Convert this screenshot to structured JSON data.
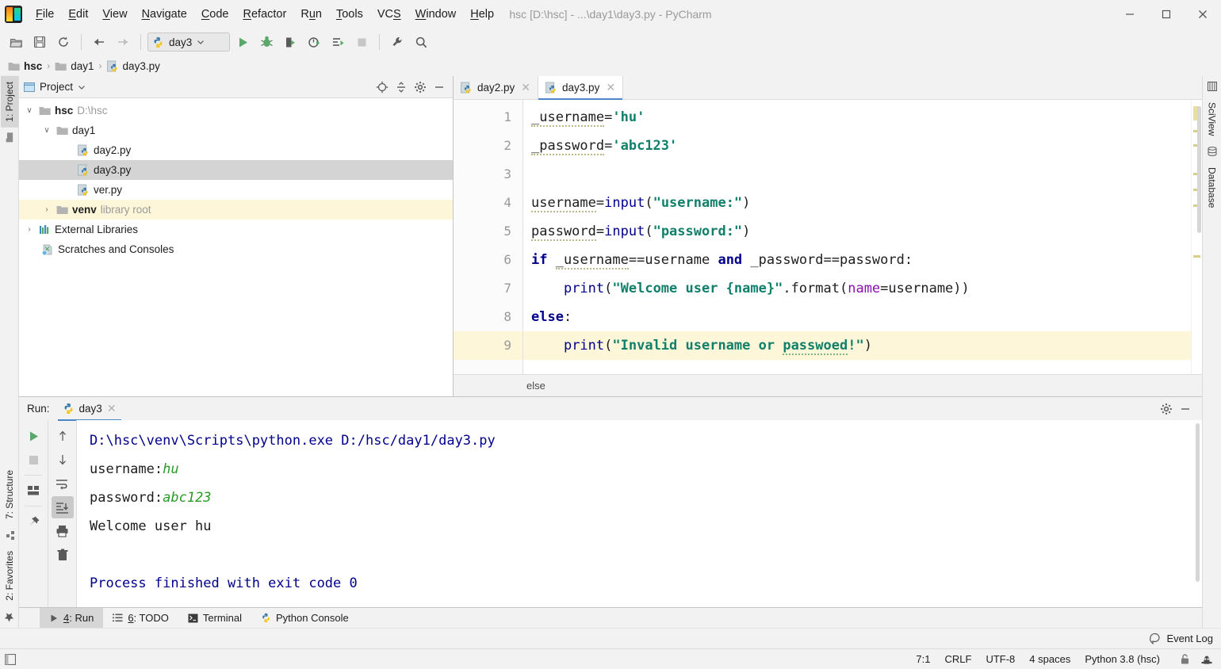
{
  "window": {
    "title": "hsc [D:\\hsc] - ...\\day1\\day3.py - PyCharm",
    "minimize": "—",
    "maximize": "☐",
    "close": "✕"
  },
  "menu": {
    "items": [
      {
        "label": "File",
        "mnemonic": "F"
      },
      {
        "label": "Edit",
        "mnemonic": "E"
      },
      {
        "label": "View",
        "mnemonic": "V"
      },
      {
        "label": "Navigate",
        "mnemonic": "N"
      },
      {
        "label": "Code",
        "mnemonic": "C"
      },
      {
        "label": "Refactor",
        "mnemonic": "R"
      },
      {
        "label": "Run",
        "mnemonic": "u"
      },
      {
        "label": "Tools",
        "mnemonic": "T"
      },
      {
        "label": "VCS",
        "mnemonic": "S"
      },
      {
        "label": "Window",
        "mnemonic": "W"
      },
      {
        "label": "Help",
        "mnemonic": "H"
      }
    ]
  },
  "toolbar": {
    "run_config": "day3",
    "buttons": [
      "open-icon",
      "save-icon",
      "sync-icon",
      "back-icon",
      "forward-icon",
      "run-icon",
      "debug-icon",
      "run-coverage-icon",
      "profile-icon",
      "run-tests-icon",
      "stop-icon",
      "settings-wrench-icon",
      "search-icon"
    ]
  },
  "breadcrumb": {
    "items": [
      "hsc",
      "day1",
      "day3.py"
    ],
    "separator": "›"
  },
  "left_strip": {
    "items": [
      {
        "label": "1: Project",
        "mnemonic": "1",
        "active": true
      },
      {
        "label": "7: Structure",
        "mnemonic": "7",
        "active": false
      },
      {
        "label": "2: Favorites",
        "mnemonic": "2",
        "active": false
      }
    ]
  },
  "right_strip": {
    "items": [
      {
        "label": "SciView"
      },
      {
        "label": "Database"
      }
    ]
  },
  "project": {
    "title": "Project",
    "tree": [
      {
        "label": "hsc",
        "detail": "D:\\hsc",
        "indent": 0,
        "arrow": "∨",
        "icon": "folder-icon",
        "bold": true,
        "state": "none"
      },
      {
        "label": "day1",
        "detail": "",
        "indent": 1,
        "arrow": "∨",
        "icon": "folder-icon",
        "bold": false,
        "state": "none"
      },
      {
        "label": "day2.py",
        "detail": "",
        "indent": 3,
        "arrow": "",
        "icon": "python-file-icon",
        "bold": false,
        "state": "none"
      },
      {
        "label": "day3.py",
        "detail": "",
        "indent": 3,
        "arrow": "",
        "icon": "python-file-icon",
        "bold": false,
        "state": "selected"
      },
      {
        "label": "ver.py",
        "detail": "",
        "indent": 3,
        "arrow": "",
        "icon": "python-file-icon",
        "bold": false,
        "state": "none"
      },
      {
        "label": "venv",
        "detail": "library root",
        "indent": 1,
        "arrow": "›",
        "icon": "folder-icon",
        "bold": true,
        "state": "highlight"
      },
      {
        "label": "External Libraries",
        "detail": "",
        "indent": 0,
        "arrow": "›",
        "icon": "libraries-icon",
        "bold": false,
        "state": "none"
      },
      {
        "label": "Scratches and Consoles",
        "detail": "",
        "indent": 1,
        "arrow": "",
        "icon": "scratches-icon",
        "bold": false,
        "state": "none"
      }
    ]
  },
  "editor": {
    "tabs": [
      {
        "label": "day2.py",
        "active": false
      },
      {
        "label": "day3.py",
        "active": true
      }
    ],
    "close_glyph": "✕",
    "lines": [
      {
        "n": "1",
        "current": false
      },
      {
        "n": "2",
        "current": false
      },
      {
        "n": "3",
        "current": false
      },
      {
        "n": "4",
        "current": false
      },
      {
        "n": "5",
        "current": false
      },
      {
        "n": "6",
        "current": false
      },
      {
        "n": "7",
        "current": false
      },
      {
        "n": "8",
        "current": false
      },
      {
        "n": "9",
        "current": true
      }
    ],
    "code_text": [
      "_username='hu'",
      "_password='abc123'",
      "",
      "username=input(\"username:\")",
      "password=input(\"password:\")",
      "if _username==username and _password==password:",
      "    print(\"Welcome user {name}\".format(name=username))",
      "else:",
      "    print(\"Invalid username or passwoed!\")"
    ],
    "breadcrumb": "else"
  },
  "run": {
    "label": "Run:",
    "tab": "day3",
    "close_glyph": "✕",
    "tools_left": [
      "rerun-icon",
      "stop-icon",
      "layout-icon",
      "pin-icon"
    ],
    "tools_right": [
      "up-icon",
      "down-icon",
      "soft-wrap-icon",
      "scroll-to-end-icon",
      "print-icon",
      "delete-icon"
    ],
    "header_actions": [
      "gear-icon",
      "hide-icon"
    ],
    "console": [
      {
        "text": "D:\\hsc\\venv\\Scripts\\python.exe D:/hsc/day1/day3.py",
        "style": "cmd"
      },
      {
        "text": "username:hu",
        "style": "prompt",
        "prompt": "username:",
        "input": "hu"
      },
      {
        "text": "password:abc123",
        "style": "prompt",
        "prompt": "password:",
        "input": "abc123"
      },
      {
        "text": "Welcome user hu",
        "style": "plain"
      },
      {
        "text": "",
        "style": "plain"
      },
      {
        "text": "Process finished with exit code 0",
        "style": "done"
      }
    ]
  },
  "toolwindow_bar": {
    "items": [
      {
        "label": "4: Run",
        "mnemonic": "4",
        "icon": "run-icon",
        "active": true
      },
      {
        "label": "6: TODO",
        "mnemonic": "6",
        "icon": "todo-icon",
        "active": false
      },
      {
        "label": "Terminal",
        "mnemonic": "",
        "icon": "terminal-icon",
        "active": false
      },
      {
        "label": "Python Console",
        "mnemonic": "",
        "icon": "python-icon",
        "active": false
      }
    ]
  },
  "event_log": {
    "label": "Event Log",
    "icon": "event-log-icon"
  },
  "status_bar": {
    "caret": "7:1",
    "line_separator": "CRLF",
    "encoding": "UTF-8",
    "indent": "4 spaces",
    "interpreter": "Python 3.8 (hsc)",
    "icons": [
      "lock-icon",
      "inspector-hat-icon"
    ]
  },
  "colors": {
    "accent": "#4a86c8",
    "string": "#10806b",
    "keyword": "#00008c",
    "named_arg": "#8b0fb0",
    "console_input": "#2a9a2a",
    "caret_line": "#fdf6d8",
    "selection": "#d4d4d4",
    "panel": "#f2f2f2"
  }
}
